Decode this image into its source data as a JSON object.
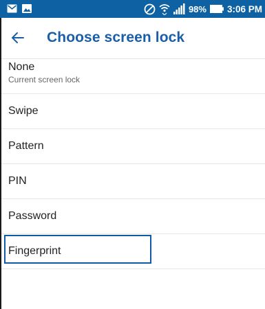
{
  "status_bar": {
    "battery_percent": "98%",
    "time": "3:06 PM",
    "icons": [
      "mail-icon",
      "image-icon",
      "do-not-disturb-icon",
      "wifi-icon",
      "signal-icon",
      "battery-icon"
    ]
  },
  "app_bar": {
    "title": "Choose screen lock",
    "back_icon": "arrow-left-icon"
  },
  "options": [
    {
      "title": "None",
      "subtitle": "Current screen lock"
    },
    {
      "title": "Swipe"
    },
    {
      "title": "Pattern"
    },
    {
      "title": "PIN"
    },
    {
      "title": "Password"
    },
    {
      "title": "Fingerprint"
    }
  ],
  "highlighted_option": "Fingerprint",
  "colors": {
    "status_bar": "#0e62a3",
    "accent": "#1a5ea8",
    "highlight_border": "#0e5aa5"
  }
}
